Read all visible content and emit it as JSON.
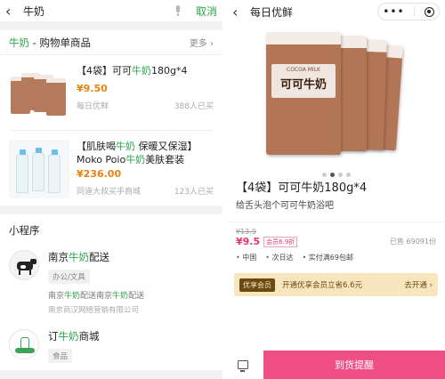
{
  "left": {
    "search": {
      "query": "牛奶",
      "cancel": "取消"
    },
    "shop_section": {
      "title_kw": "牛奶",
      "title_rest": " - 购物单商品",
      "more": "更多 ›",
      "items": [
        {
          "title_pre": "【4袋】可可",
          "title_kw": "牛奶",
          "title_post": "180g*4",
          "price": "¥9.50",
          "store": "每日优鲜",
          "sold": "388人已买"
        },
        {
          "title_pre": "【肌肤喝",
          "title_kw": "牛奶",
          "title_post": " 保暖又保湿】",
          "title2_pre": "Moko Poio",
          "title2_kw": "牛奶",
          "title2_post": "美肤套装",
          "price": "¥236.00",
          "store": "同道大叔买手商城",
          "sold": "123人已买"
        }
      ]
    },
    "mini_programs": {
      "title": "小程序",
      "items": [
        {
          "name_pre": "南京",
          "name_kw": "牛奶",
          "name_post": "配送",
          "tag": "办公/文具",
          "desc_pre": "南京",
          "desc_kw": "牛奶",
          "desc_mid": "配送南京",
          "desc_kw2": "牛奶",
          "desc_post": "配送",
          "company": "南京商汉网络营销有限公司"
        },
        {
          "name_pre": "订",
          "name_kw": "牛奶",
          "name_post": "商城",
          "tag": "食品"
        }
      ]
    }
  },
  "right": {
    "header_title": "每日优鲜",
    "capsule_dots": "•••",
    "product": {
      "bag_label_small": "COCOA MILK",
      "bag_label_big": "可可牛奶",
      "title": "【4袋】可可牛奶180g*4",
      "subtitle": "给舌头泡个可可牛奶浴吧",
      "original_price": "¥13.9",
      "price": "¥9.5",
      "member_tag": "会员6.9折",
      "sold": "已售 69091份",
      "badges": [
        "中国",
        "次日达",
        "实付满69包邮"
      ]
    },
    "vip": {
      "tag": "优享会员",
      "text": "开通优享会员立省6.6元",
      "action": "去开通 ›"
    },
    "notify_button": "到货提醒"
  },
  "colors": {
    "brand_green": "#2aa34a",
    "price_orange": "#e8820c",
    "pink": "#ef4f84"
  }
}
